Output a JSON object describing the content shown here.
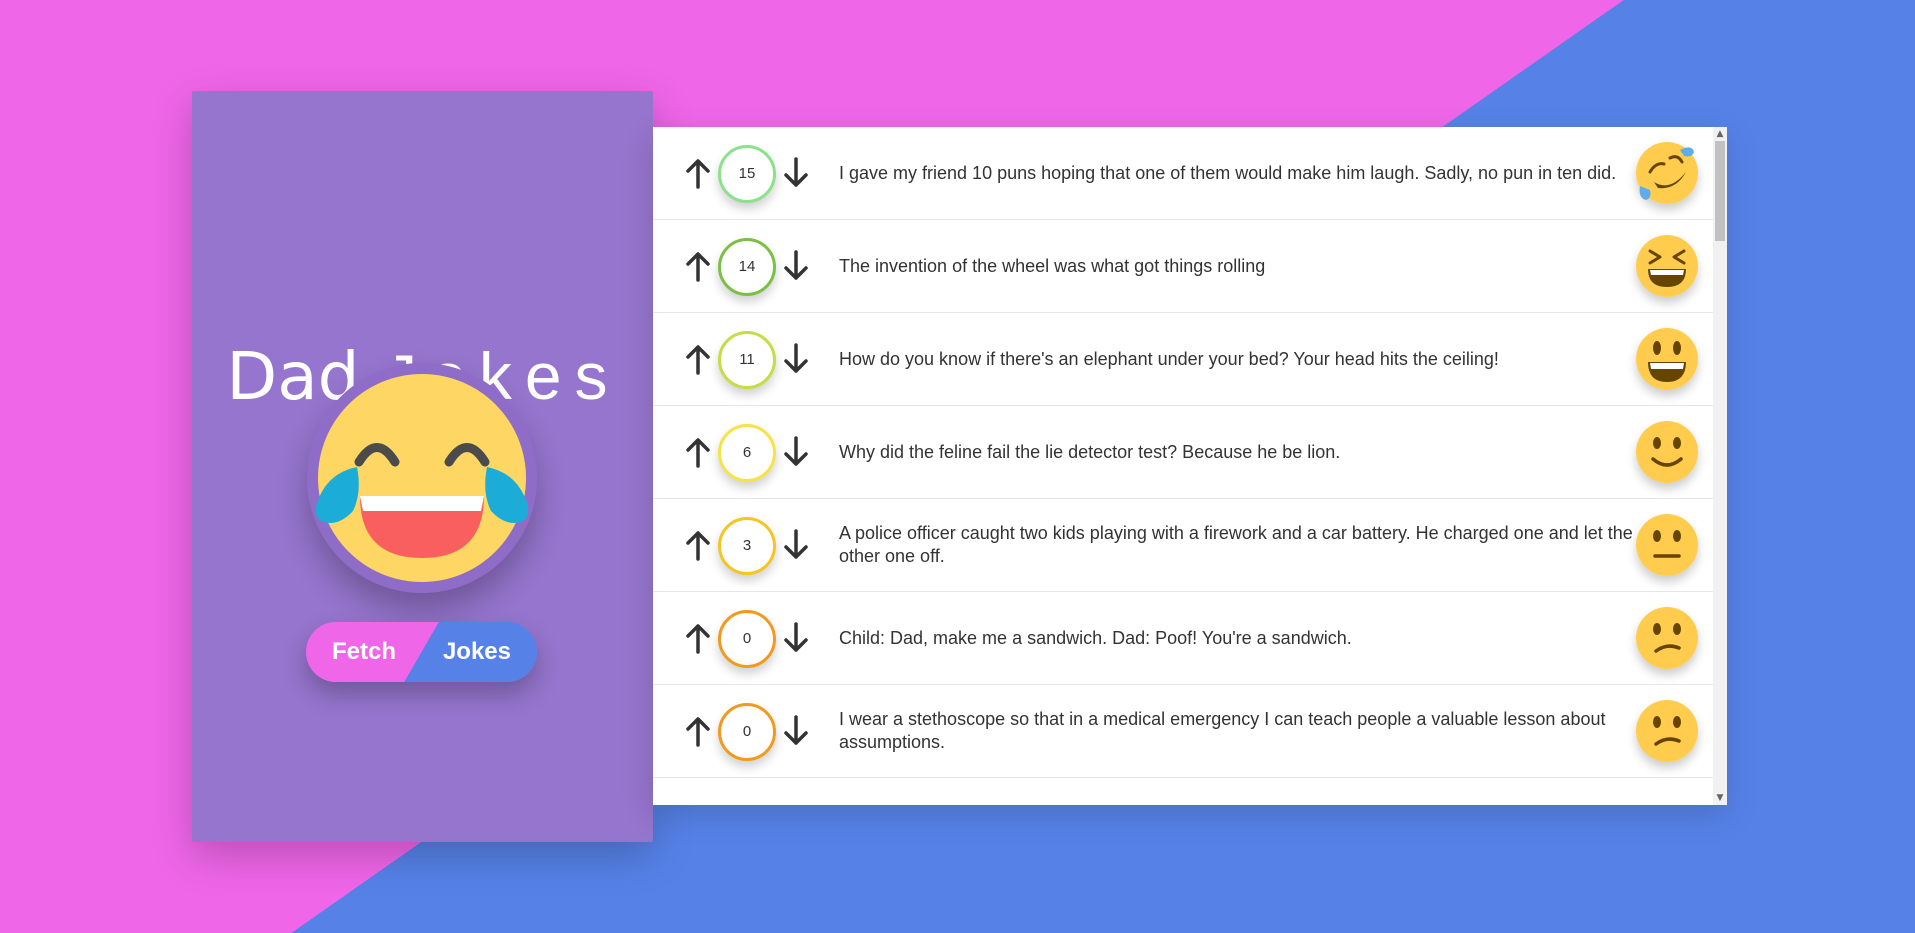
{
  "sidebar": {
    "title_part1": "Dad",
    "title_part2": "Jokes",
    "fetch_word1": "Fetch",
    "fetch_word2": "Jokes",
    "main_emoji": "tears-of-joy-icon"
  },
  "colors": {
    "background_pink": "#EF66E9",
    "background_blue": "#5682E8",
    "sidebar": "#9575CD"
  },
  "jokes": [
    {
      "votes": "15",
      "text": "I gave my friend 10 puns hoping that one of them would make him laugh. Sadly, no pun in ten did.",
      "border": "#8BC34A",
      "emoji": "rolling-on-floor-laughing-icon"
    },
    {
      "votes": "14",
      "text": "The invention of the wheel was what got things rolling",
      "border": "#8BC34A",
      "emoji": "grinning-squinting-icon"
    },
    {
      "votes": "11",
      "text": "How do you know if there's an elephant under your bed? Your head hits the ceiling!",
      "border": "#CDDC39",
      "emoji": "grinning-face-icon"
    },
    {
      "votes": "6",
      "text": "Why did the feline fail the lie detector test? Because he be lion.",
      "border": "#FFEB3B",
      "emoji": "slightly-smiling-icon"
    },
    {
      "votes": "3",
      "text": "A police officer caught two kids playing with a firework and a car battery. He charged one and let the other one off.",
      "border": "#FFC107",
      "emoji": "neutral-face-icon"
    },
    {
      "votes": "0",
      "text": "Child: Dad, make me a sandwich. Dad: Poof! You're a sandwich.",
      "border": "#FF9800",
      "emoji": "confused-face-icon"
    },
    {
      "votes": "0",
      "text": "I wear a stethoscope so that in a medical emergency I can teach people a valuable lesson about assumptions.",
      "border": "#FF9800",
      "emoji": "confused-face-icon"
    }
  ]
}
